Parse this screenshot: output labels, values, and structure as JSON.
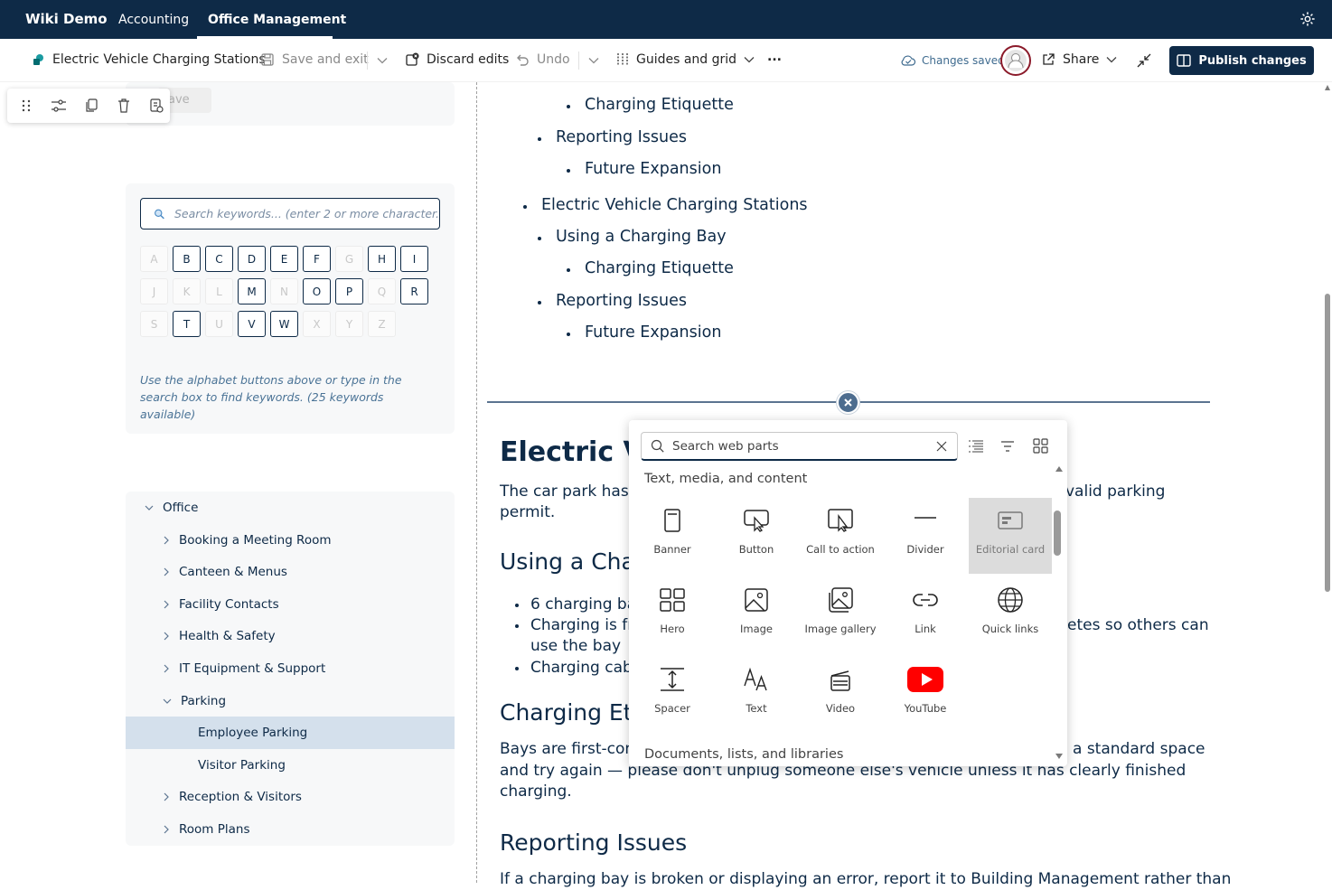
{
  "topbar": {
    "brand": "Wiki Demo",
    "nav": [
      "Accounting",
      "Office Management"
    ]
  },
  "cmdbar": {
    "page_name": "Electric Vehicle Charging Stations",
    "save_exit": "Save and exit",
    "discard": "Discard edits",
    "undo": "Undo",
    "guides": "Guides and grid",
    "more": "...",
    "saved_status": "Changes saved",
    "share": "Share",
    "publish": "Publish changes"
  },
  "floatbar": {
    "ghost_label": "ave"
  },
  "keywords": {
    "placeholder": "Search keywords... (enter 2 or more character.",
    "letters": [
      "A",
      "B",
      "C",
      "D",
      "E",
      "F",
      "G",
      "H",
      "I",
      "J",
      "K",
      "L",
      "M",
      "N",
      "O",
      "P",
      "Q",
      "R",
      "S",
      "T",
      "U",
      "V",
      "W",
      "X",
      "Y",
      "Z"
    ],
    "enabled": [
      "B",
      "C",
      "D",
      "E",
      "F",
      "H",
      "I",
      "M",
      "O",
      "P",
      "R",
      "T",
      "V",
      "W"
    ],
    "hint": "Use the alphabet buttons above or type in the search box to find keywords. (25 keywords available)"
  },
  "tree": {
    "root": "Office",
    "items": [
      "Booking a Meeting Room",
      "Canteen & Menus",
      "Facility Contacts",
      "Health & Safety",
      "IT Equipment & Support",
      "Parking",
      "Employee Parking",
      "Visitor Parking",
      "Reception & Visitors",
      "Room Plans"
    ]
  },
  "toc": {
    "items": [
      "Charging Etiquette",
      "Reporting Issues",
      "Future Expansion",
      "Electric Vehicle Charging Stations",
      "Using a Charging Bay",
      "Charging Etiquette",
      "Reporting Issues",
      "Future Expansion"
    ]
  },
  "article": {
    "h1": "Electric Ve",
    "intro_1": "The car park has d",
    "intro_1_right": "valid parking",
    "intro_2": "permit.",
    "h2_using": "Using a Cha",
    "bullet_1": "6 charging ba",
    "bullet_2": "Charging is fr",
    "bullet_2_right": "etes so others can",
    "bullet_2b": "use the bay",
    "bullet_3": "Charging cabl",
    "h2_etiquette": "Charging Etic",
    "etiq_1": "Bays are first-come",
    "etiq_1_right": "a standard space",
    "etiq_2": "and try again — please don't unplug someone else's vehicle unless it has clearly finished",
    "etiq_3": "charging.",
    "h2_reporting": "Reporting Issues",
    "report_1": "If a charging bay is broken or displaying an error, report it to Building Management rather than"
  },
  "webparts": {
    "search_placeholder": "Search web parts",
    "section_1": "Text, media, and content",
    "section_2": "Documents, lists, and libraries",
    "items": [
      "Banner",
      "Button",
      "Call to action",
      "Divider",
      "Editorial card",
      "Hero",
      "Image",
      "Image gallery",
      "Link",
      "Quick links",
      "Spacer",
      "Text",
      "Video",
      "YouTube"
    ]
  }
}
